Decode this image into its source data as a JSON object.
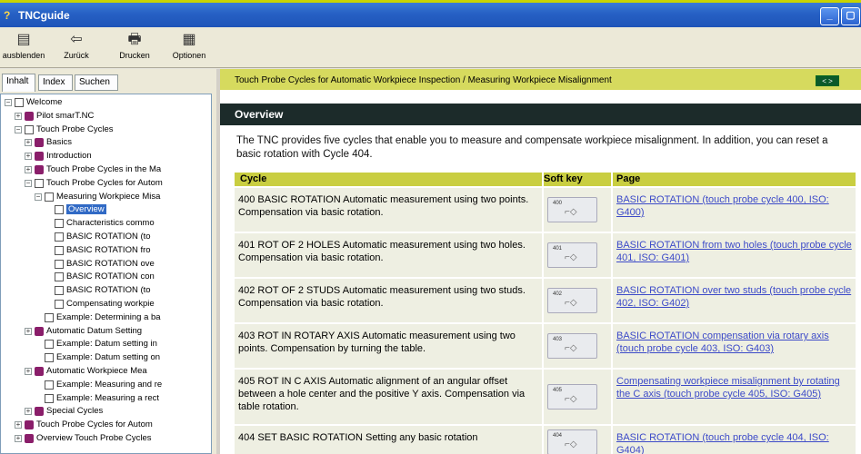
{
  "window": {
    "title": "TNCguide",
    "min_label": "_",
    "max_label": "▢"
  },
  "toolbar": {
    "buttons": [
      {
        "label": "ausblenden",
        "icon": "hide-pane-icon"
      },
      {
        "label": "Zurück",
        "icon": "back-arrow-icon"
      },
      {
        "label": "Drucken",
        "icon": "printer-icon"
      },
      {
        "label": "Optionen",
        "icon": "options-icon"
      }
    ]
  },
  "tabs": {
    "inhalt": "Inhalt",
    "index": "Index",
    "suchen": "Suchen"
  },
  "tree": {
    "items": [
      {
        "label": "Welcome",
        "indent": 0,
        "exp": "−",
        "icon": "open"
      },
      {
        "label": "Pilot smarT.NC",
        "indent": 1,
        "exp": "+",
        "icon": "closed"
      },
      {
        "label": "Touch Probe Cycles",
        "indent": 1,
        "exp": "−",
        "icon": "open"
      },
      {
        "label": "Basics",
        "indent": 2,
        "exp": "+",
        "icon": "closed"
      },
      {
        "label": "Introduction",
        "indent": 2,
        "exp": "+",
        "icon": "closed"
      },
      {
        "label": "Touch Probe Cycles in the Ma",
        "indent": 2,
        "exp": "+",
        "icon": "closed"
      },
      {
        "label": "Touch Probe Cycles for Autom",
        "indent": 2,
        "exp": "−",
        "icon": "open"
      },
      {
        "label": "Measuring Workpiece Misa",
        "indent": 3,
        "exp": "−",
        "icon": "open"
      },
      {
        "label": "Overview",
        "indent": 4,
        "exp": "",
        "icon": "page",
        "selected": true
      },
      {
        "label": "Characteristics commo",
        "indent": 4,
        "exp": "",
        "icon": "page"
      },
      {
        "label": "BASIC ROTATION (to",
        "indent": 4,
        "exp": "",
        "icon": "page"
      },
      {
        "label": "BASIC ROTATION fro",
        "indent": 4,
        "exp": "",
        "icon": "page"
      },
      {
        "label": "BASIC ROTATION ove",
        "indent": 4,
        "exp": "",
        "icon": "page"
      },
      {
        "label": "BASIC ROTATION con",
        "indent": 4,
        "exp": "",
        "icon": "page"
      },
      {
        "label": "BASIC ROTATION (to",
        "indent": 4,
        "exp": "",
        "icon": "page"
      },
      {
        "label": "Compensating workpie",
        "indent": 4,
        "exp": "",
        "icon": "page"
      },
      {
        "label": "Example: Determining a ba",
        "indent": 3,
        "exp": "",
        "icon": "page"
      },
      {
        "label": "Automatic Datum Setting",
        "indent": 2,
        "exp": "+",
        "icon": "closed"
      },
      {
        "label": "Example: Datum setting in",
        "indent": 3,
        "exp": "",
        "icon": "page"
      },
      {
        "label": "Example: Datum setting on",
        "indent": 3,
        "exp": "",
        "icon": "page"
      },
      {
        "label": "Automatic Workpiece Mea",
        "indent": 2,
        "exp": "+",
        "icon": "closed"
      },
      {
        "label": "Example: Measuring and re",
        "indent": 3,
        "exp": "",
        "icon": "page"
      },
      {
        "label": "Example: Measuring a rect",
        "indent": 3,
        "exp": "",
        "icon": "page"
      },
      {
        "label": "Special Cycles",
        "indent": 2,
        "exp": "+",
        "icon": "closed"
      },
      {
        "label": "Touch Probe Cycles for Autom",
        "indent": 1,
        "exp": "+",
        "icon": "closed"
      },
      {
        "label": "Overview Touch Probe Cycles",
        "indent": 1,
        "exp": "+",
        "icon": "closed"
      }
    ]
  },
  "topic": {
    "breadcrumb": "Touch Probe Cycles for Automatic Workpiece Inspection / Measuring Workpiece Misalignment",
    "nav": "< >",
    "section_title": "Overview",
    "intro": "The TNC provides five cycles that enable you to measure and compensate workpiece misalignment. In addition, you can reset a basic rotation with Cycle 404."
  },
  "table": {
    "headers": {
      "cycle": "Cycle",
      "softkey": "Soft key",
      "page": "Page"
    },
    "rows": [
      {
        "cycle": "400 BASIC ROTATION Automatic measurement using two points. Compensation via basic rotation.",
        "softkey": "400",
        "page": "BASIC ROTATION (touch probe cycle 400, ISO: G400)"
      },
      {
        "cycle": "401 ROT OF 2 HOLES Automatic measurement using two holes. Compensation via basic rotation.",
        "softkey": "401",
        "page": "BASIC ROTATION from two holes (touch probe cycle 401, ISO: G401)"
      },
      {
        "cycle": "402 ROT OF 2 STUDS Automatic measurement using two studs. Compensation via basic rotation.",
        "softkey": "402",
        "page": "BASIC ROTATION over two studs (touch probe cycle 402, ISO: G402)"
      },
      {
        "cycle": "403 ROT IN ROTARY AXIS Automatic measurement using two points. Compensation by turning the table.",
        "softkey": "403",
        "page": "BASIC ROTATION compensation via rotary axis (touch probe cycle 403, ISO: G403)"
      },
      {
        "cycle": "405 ROT IN C AXIS Automatic alignment of an angular offset between a hole center and the positive Y axis. Compensation via table rotation.",
        "softkey": "405",
        "page": "Compensating workpiece misalignment by rotating the C axis (touch probe cycle 405, ISO: G405)"
      },
      {
        "cycle": "404 SET BASIC ROTATION Setting any basic rotation",
        "softkey": "404",
        "page": "BASIC ROTATION (touch probe cycle 404, ISO: G404)"
      }
    ]
  }
}
